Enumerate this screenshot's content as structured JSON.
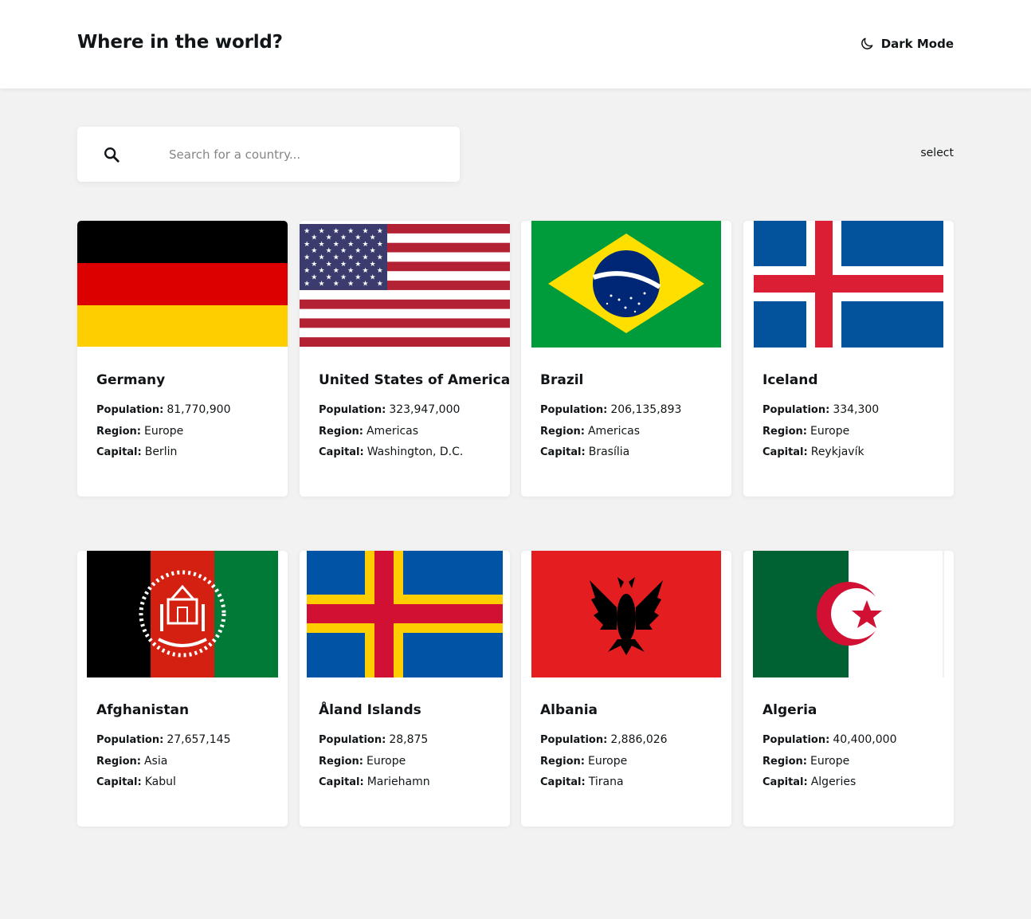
{
  "header": {
    "title": "Where in the world?",
    "dark_mode_label": "Dark Mode"
  },
  "search": {
    "placeholder": "Search for a country...",
    "value": ""
  },
  "filter": {
    "label": "select"
  },
  "stat_labels": {
    "population": "Population:",
    "region": "Region:",
    "capital": "Capital:"
  },
  "countries": [
    {
      "name": "Germany",
      "population": "81,770,900",
      "region": "Europe",
      "capital": "Berlin"
    },
    {
      "name": "United States of America",
      "population": "323,947,000",
      "region": "Americas",
      "capital": "Washington, D.C."
    },
    {
      "name": "Brazil",
      "population": "206,135,893",
      "region": "Americas",
      "capital": "Brasília"
    },
    {
      "name": "Iceland",
      "population": "334,300",
      "region": "Europe",
      "capital": "Reykjavík"
    },
    {
      "name": "Afghanistan",
      "population": "27,657,145",
      "region": "Asia",
      "capital": "Kabul"
    },
    {
      "name": "Åland Islands",
      "population": "28,875",
      "region": "Europe",
      "capital": "Mariehamn"
    },
    {
      "name": "Albania",
      "population": "2,886,026",
      "region": "Europe",
      "capital": "Tirana"
    },
    {
      "name": "Algeria",
      "population": "40,400,000",
      "region": "Europe",
      "capital": "Algeries"
    }
  ],
  "colors": {
    "background": "#f2f2f2",
    "surface": "#ffffff",
    "text": "#111517",
    "placeholder": "#858585"
  }
}
